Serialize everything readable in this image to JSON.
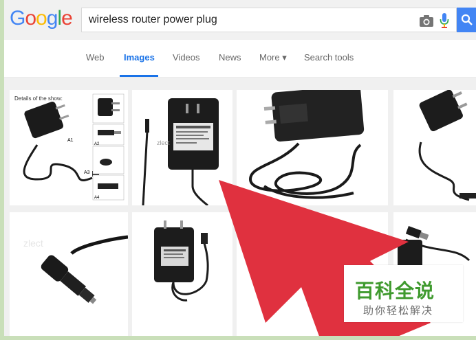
{
  "logo": {
    "letters": [
      "G",
      "o",
      "o",
      "g",
      "l",
      "e"
    ],
    "colors": [
      "#4285f4",
      "#ea4335",
      "#fbbc05",
      "#4285f4",
      "#34a853",
      "#ea4335"
    ]
  },
  "search": {
    "query": "wireless router power plug"
  },
  "tabs": [
    {
      "label": "Web"
    },
    {
      "label": "Images",
      "active": true
    },
    {
      "label": "Videos"
    },
    {
      "label": "News"
    },
    {
      "label": "More ▾"
    },
    {
      "label": "Search tools"
    }
  ],
  "results": {
    "first_caption": "Details of the show:",
    "labels": [
      "A1",
      "A2",
      "A3",
      "A4"
    ],
    "watermark": "zlect"
  },
  "overlay": {
    "arrow_color": "#e0303e"
  },
  "badge": {
    "title": "百科全说",
    "subtitle": "助你轻松解决"
  },
  "colors": {
    "accent": "#1a73e8",
    "search_button": "#4285f4",
    "background_border": "#c9dfb9"
  }
}
